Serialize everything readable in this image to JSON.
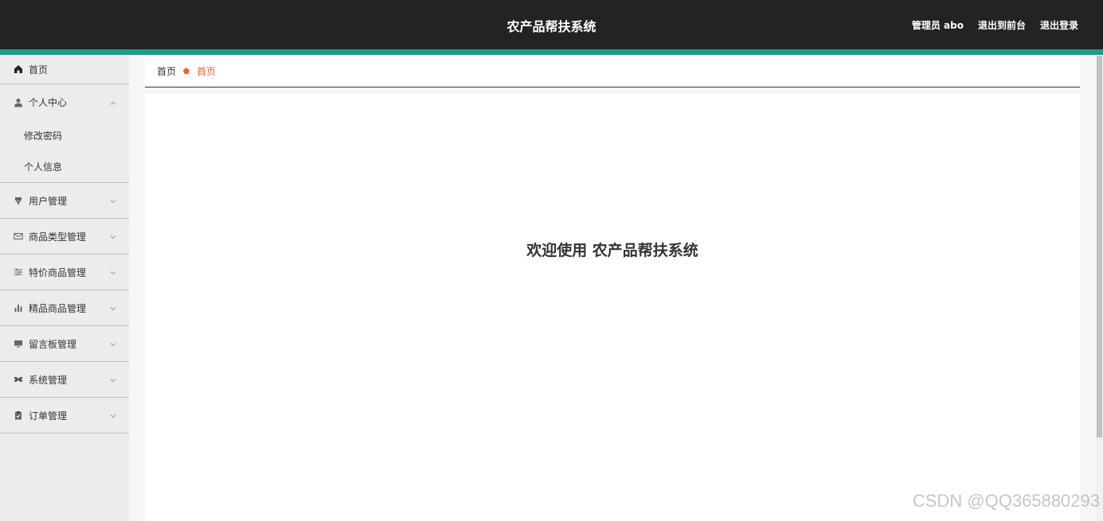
{
  "header": {
    "title": "农产品帮扶系统",
    "admin_label": "管理员 abo",
    "to_frontend": "退出到前台",
    "logout": "退出登录"
  },
  "sidebar": {
    "home": "首页",
    "personal_center": "个人中心",
    "change_password": "修改密码",
    "personal_info": "个人信息",
    "items": [
      {
        "label": "用户管理",
        "icon": "user-mgmt-icon"
      },
      {
        "label": "商品类型管理",
        "icon": "mail-icon"
      },
      {
        "label": "特价商品管理",
        "icon": "sliders-icon"
      },
      {
        "label": "精品商品管理",
        "icon": "bar-chart-icon"
      },
      {
        "label": "留言板管理",
        "icon": "monitor-icon"
      },
      {
        "label": "系统管理",
        "icon": "system-icon"
      },
      {
        "label": "订单管理",
        "icon": "clipboard-icon"
      }
    ]
  },
  "breadcrumb": {
    "home": "首页",
    "current": "首页"
  },
  "main": {
    "welcome": "欢迎使用 农产品帮扶系统"
  },
  "watermark": "CSDN @QQ365880293",
  "colors": {
    "header_bg": "#232323",
    "accent": "#1a9c8c",
    "breadcrumb_current": "#f0642b"
  }
}
